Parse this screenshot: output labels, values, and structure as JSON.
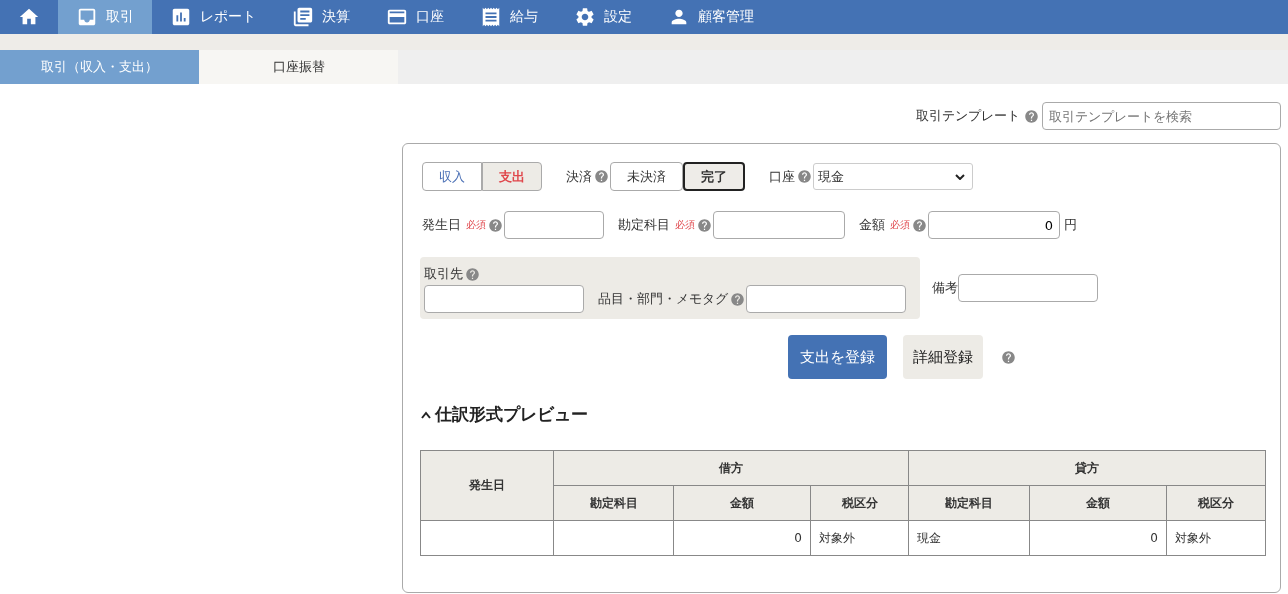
{
  "nav": [
    {
      "selected": false
    },
    {
      "label": "取引",
      "selected": true
    },
    {
      "label": "レポート",
      "selected": false
    },
    {
      "label": "決算",
      "selected": false
    },
    {
      "label": "口座",
      "selected": false
    },
    {
      "label": "給与",
      "selected": false
    },
    {
      "label": "設定",
      "selected": false
    },
    {
      "label": "顧客管理",
      "selected": false
    }
  ],
  "subtabs": [
    {
      "label": "取引（収入・支出）",
      "selected": true
    },
    {
      "label": "口座振替",
      "selected": false
    }
  ],
  "template": {
    "label": "取引テンプレート",
    "placeholder": "取引テンプレートを検索"
  },
  "entry_type": [
    {
      "label": "収入",
      "selected": false
    },
    {
      "label": "支出",
      "selected": true
    }
  ],
  "settlement": {
    "label": "決済",
    "options": [
      {
        "label": "未決済",
        "selected": false
      },
      {
        "label": "完了",
        "selected": true
      }
    ]
  },
  "account": {
    "label": "口座",
    "value": "現金"
  },
  "fields": [
    {
      "label": "発生日",
      "required": "必須"
    },
    {
      "label": "勘定科目",
      "required": "必須"
    },
    {
      "label": "金額",
      "required": "必須",
      "value": "0",
      "unit": "円"
    }
  ],
  "partner": {
    "label": "取引先"
  },
  "tags": {
    "label": "品目・部門・メモタグ"
  },
  "memo": {
    "label": "備考"
  },
  "buttons": {
    "primary": "支出を登録",
    "secondary": "詳細登録"
  },
  "preview": {
    "title": "仕訳形式プレビュー",
    "expanded": true,
    "date_header": "発生日",
    "debit_header": "借方",
    "credit_header": "貸方",
    "subcolumns": [
      "勘定科目",
      "金額",
      "税区分",
      "勘定科目",
      "金額",
      "税区分"
    ],
    "rows": [
      [
        "",
        "",
        "0",
        "対象外",
        "現金",
        "0",
        "対象外"
      ]
    ]
  }
}
